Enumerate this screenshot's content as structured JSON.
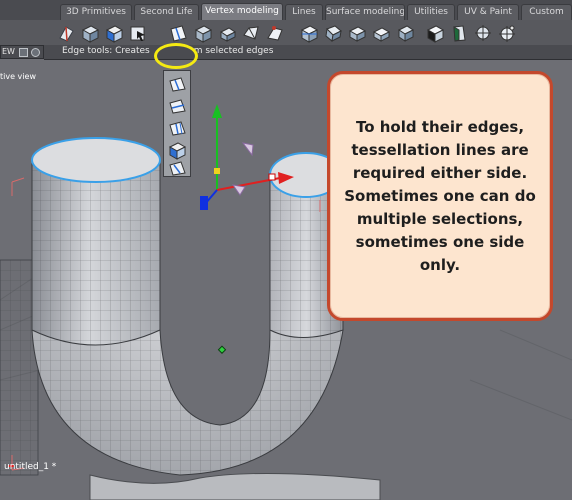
{
  "tabs": [
    {
      "label": "3D Primitives",
      "active": false
    },
    {
      "label": "Second Life",
      "active": false
    },
    {
      "label": "Vertex modeling",
      "active": true
    },
    {
      "label": "Lines",
      "active": false
    },
    {
      "label": "Surface modeling",
      "active": false
    },
    {
      "label": "Utilities",
      "active": false
    },
    {
      "label": "UV & Paint",
      "active": false
    },
    {
      "label": "Custom",
      "active": false
    }
  ],
  "left_control": {
    "label": "EW"
  },
  "tooltip": {
    "text": "Edge tools: Creates",
    "text_tail": "m selected edges"
  },
  "viewport": {
    "label": "tive view"
  },
  "callout": {
    "lines": [
      "To hold their edges,",
      "tessellation lines are",
      "required either side.",
      "Sometimes one can do",
      "multiple selections,",
      "sometimes one side only."
    ]
  },
  "file": {
    "name": "untitled_1 *"
  },
  "colors": {
    "background": "#6d6e74",
    "callout_fill": "#fde5cf",
    "callout_border": "#c4482c",
    "highlight_ring": "#f5ea12",
    "edge_highlight": "#3aa0e8",
    "gizmo_y": "#18c022",
    "gizmo_x": "#e02020",
    "gizmo_z": "#1030e0"
  },
  "toolbar_icons": [
    "edge-tool-icon",
    "box-tool-icon",
    "cube-tool-icon",
    "select-tool-icon",
    "edge-tools-icon",
    "cut-tool-icon",
    "extrude-tool-icon",
    "bevel-tool-icon",
    "weld-tool-icon",
    "bridge-tool-icon",
    "sweep-tool-icon",
    "lathe-tool-icon",
    "sphere-tool-icon",
    "cube-deform-icon",
    "taper-tool-icon",
    "shell-tool-icon",
    "subdivide-tool-icon",
    "smooth-tool-icon",
    "transform-tool-icon",
    "split-tool-icon"
  ],
  "flyout_icons": [
    "edge-slide-icon",
    "edge-loop-icon",
    "edge-insert-icon",
    "edge-bevel-icon",
    "edge-split-icon"
  ]
}
